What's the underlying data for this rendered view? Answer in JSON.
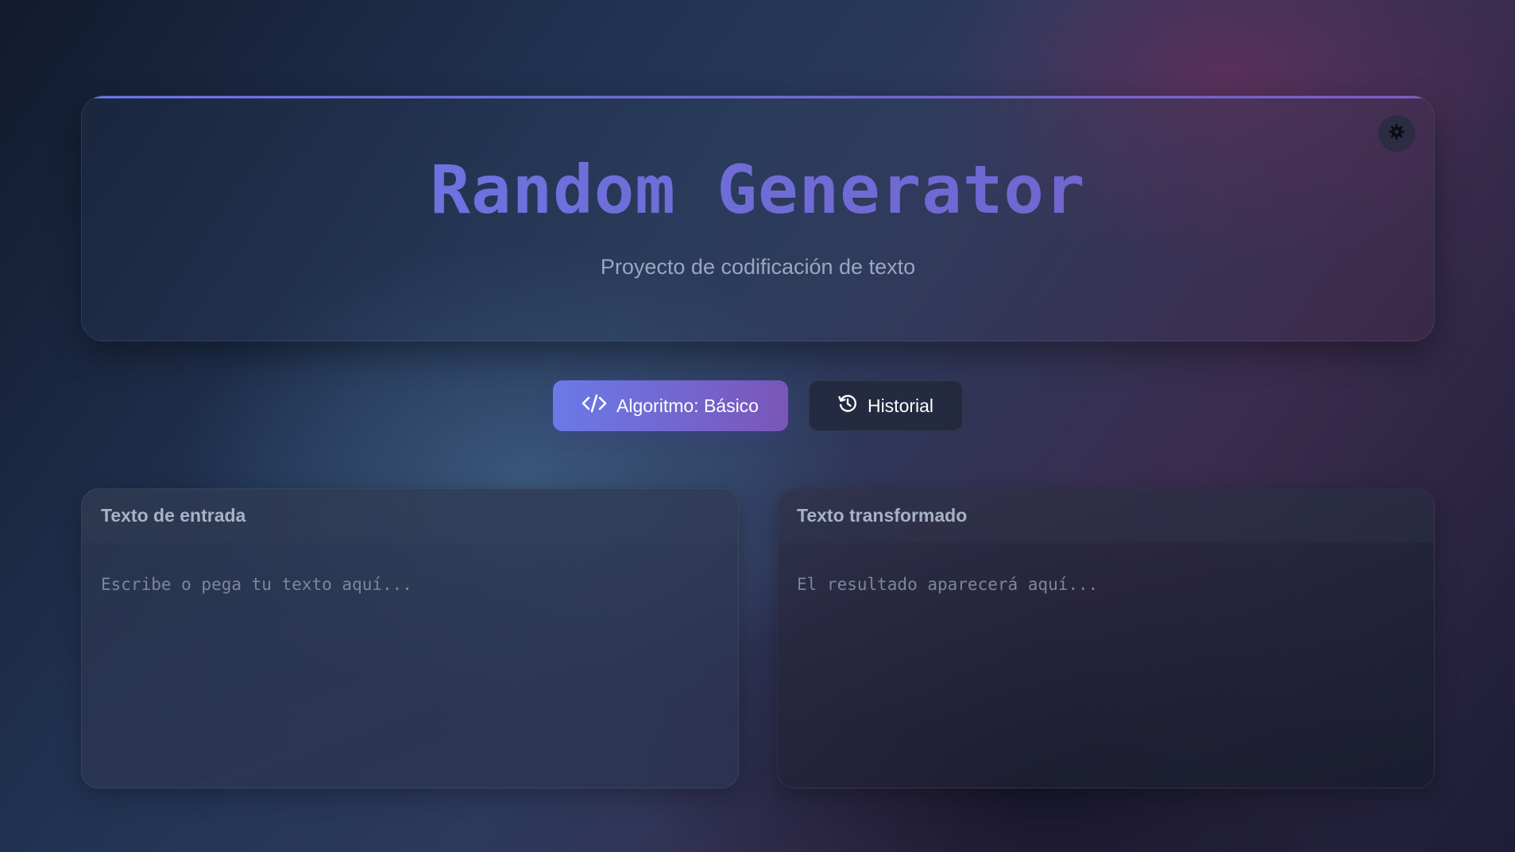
{
  "header": {
    "title": "Random Generator",
    "subtitle": "Proyecto de codificación de texto",
    "theme_toggle_icon": "gear-icon"
  },
  "actions": {
    "algorithm_button": {
      "label": "Algoritmo: Básico",
      "icon": "code-icon"
    },
    "history_button": {
      "label": "Historial",
      "icon": "history-icon"
    }
  },
  "input_panel": {
    "title": "Texto de entrada",
    "placeholder": "Escribe o pega tu texto aquí...",
    "value": ""
  },
  "output_panel": {
    "title": "Texto transformado",
    "placeholder": "El resultado aparecerá aquí...",
    "value": ""
  },
  "colors": {
    "accent_start": "#6a7ae8",
    "accent_end": "#7a56b8",
    "title_gradient_start": "#6b78e6",
    "title_gradient_end": "#7360c8"
  }
}
